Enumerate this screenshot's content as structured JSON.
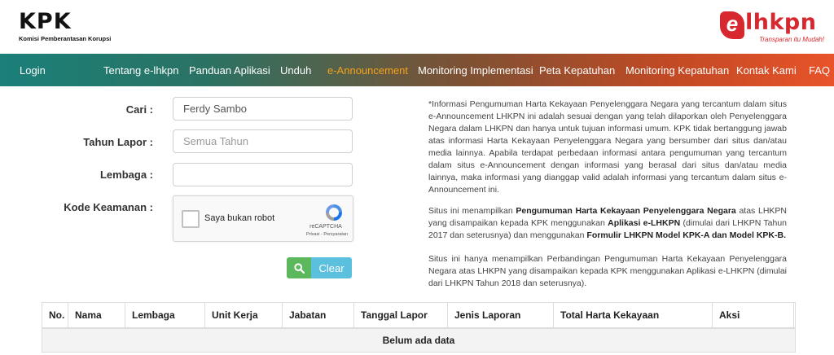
{
  "header": {
    "kpk_logo_text": "KPK",
    "kpk_subtitle": "Komisi Pemberantasan Korupsi",
    "elhkpn_e": "e",
    "elhkpn_text": "lhkpn",
    "elhkpn_tagline": "Transparan itu Mudah!"
  },
  "nav": {
    "items": [
      {
        "label": "Login"
      },
      {
        "label": "Tentang e-lhkpn"
      },
      {
        "label": "Panduan Aplikasi"
      },
      {
        "label": "Unduh"
      },
      {
        "label": "e-Announcement"
      },
      {
        "label": "Monitoring Implementasi"
      },
      {
        "label": "Peta Kepatuhan"
      },
      {
        "label": "Monitoring Kepatuhan"
      },
      {
        "label": "Kontak Kami"
      },
      {
        "label": "FAQ"
      }
    ],
    "active_index": 4,
    "active_color": "#f6a21a"
  },
  "form": {
    "cari_label": "Cari :",
    "cari_value": "Ferdy Sambo",
    "tahun_label": "Tahun Lapor :",
    "tahun_placeholder": "Semua Tahun",
    "lembaga_label": "Lembaga :",
    "lembaga_value": "",
    "kode_label": "Kode Keamanan :",
    "captcha_label": "Saya bukan robot",
    "captcha_brand": "reCAPTCHA",
    "captcha_links": "Privasi - Persyaratan",
    "clear_label": "Clear"
  },
  "info": {
    "p1": "*Informasi Pengumuman Harta Kekayaan Penyelenggara Negara yang tercantum dalam situs e-Announcement LHKPN ini adalah sesuai dengan yang telah dilaporkan oleh Penyelenggara Negara dalam LHKPN dan hanya untuk tujuan informasi umum. KPK tidak bertanggung jawab atas informasi Harta Kekayaan Penyelenggara Negara yang bersumber dari situs dan/atau media lainnya. Apabila terdapat perbedaan informasi antara pengumuman yang tercantum dalam situs e-Announcement dengan informasi yang berasal dari situs dan/atau media lainnya, maka informasi yang dianggap valid adalah informasi yang tercantum dalam situs e-Announcement ini.",
    "p2_a": "Situs ini menampilkan ",
    "p2_b": "Pengumuman Harta Kekayaan Penyelenggara Negara",
    "p2_c": " atas LHKPN yang disampaikan kepada KPK menggunakan ",
    "p2_d": "Aplikasi e-LHKPN",
    "p2_e": " (dimulai dari LHKPN Tahun 2017 dan seterusnya) dan menggunakan ",
    "p2_f": "Formulir LHKPN Model KPK-A dan Model KPK-B.",
    "p3": "Situs ini hanya menampilkan Perbandingan Pengumuman Harta Kekayaan Penyelenggara Negara atas LHKPN yang disampaikan kepada KPK menggunakan Aplikasi e-LHKPN (dimulai dari LHKPN Tahun 2018 dan seterusnya)."
  },
  "table": {
    "columns": [
      "No.",
      "Nama",
      "Lembaga",
      "Unit Kerja",
      "Jabatan",
      "Tanggal Lapor",
      "Jenis Laporan",
      "Total Harta Kekayaan",
      "Aksi"
    ],
    "empty_text": "Belum ada data"
  },
  "colors": {
    "nav_gradient_start": "#1a8079",
    "nav_gradient_end": "#e8532a",
    "search_button": "#5cb85c",
    "clear_button": "#5bc0de",
    "brand_red": "#d7282f"
  }
}
